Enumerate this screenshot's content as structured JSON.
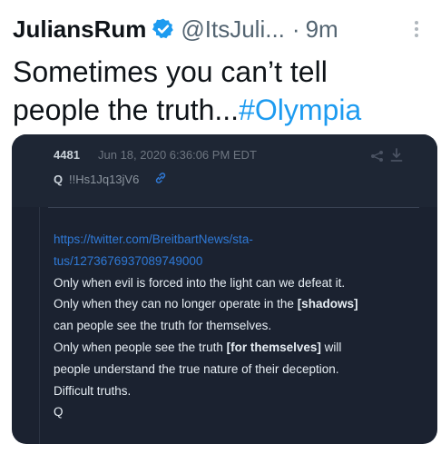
{
  "tweet": {
    "display_name": "JuliansRum",
    "handle": "@ItsJuli...",
    "separator": "·",
    "time": "9m",
    "text_line1": "Sometimes you can’t tell",
    "text_line2_prefix": "people the truth...",
    "hashtag": "#Olympia"
  },
  "post": {
    "number": "4481",
    "date": "Jun 18, 2020 6:36:06 PM EDT",
    "author": "Q",
    "tripcode": "!!Hs1Jq13jV6",
    "url_line1": "https://twitter.com/BreitbartNews/sta-",
    "url_line2": "tus/1273676937089749000",
    "lines": [
      {
        "pre": "Only when evil is forced into the light can we defeat it.",
        "bold": "",
        "post": ""
      },
      {
        "pre": "Only when they can no longer operate in the ",
        "bold": "[shadows]",
        "post": ""
      },
      {
        "pre": "can people see the truth for themselves.",
        "bold": "",
        "post": ""
      },
      {
        "pre": "Only when people see the truth ",
        "bold": "[for themselves]",
        "post": " will"
      },
      {
        "pre": "people understand the true nature of their deception.",
        "bold": "",
        "post": ""
      },
      {
        "pre": "Difficult truths.",
        "bold": "",
        "post": ""
      }
    ],
    "signature": "Q"
  },
  "colors": {
    "accent": "#1d9bf0",
    "card_bg": "#1b2230",
    "link": "#2f79d6"
  },
  "icons": [
    "verified-badge-icon",
    "more-options-icon",
    "link-icon",
    "share-icon",
    "download-icon"
  ]
}
